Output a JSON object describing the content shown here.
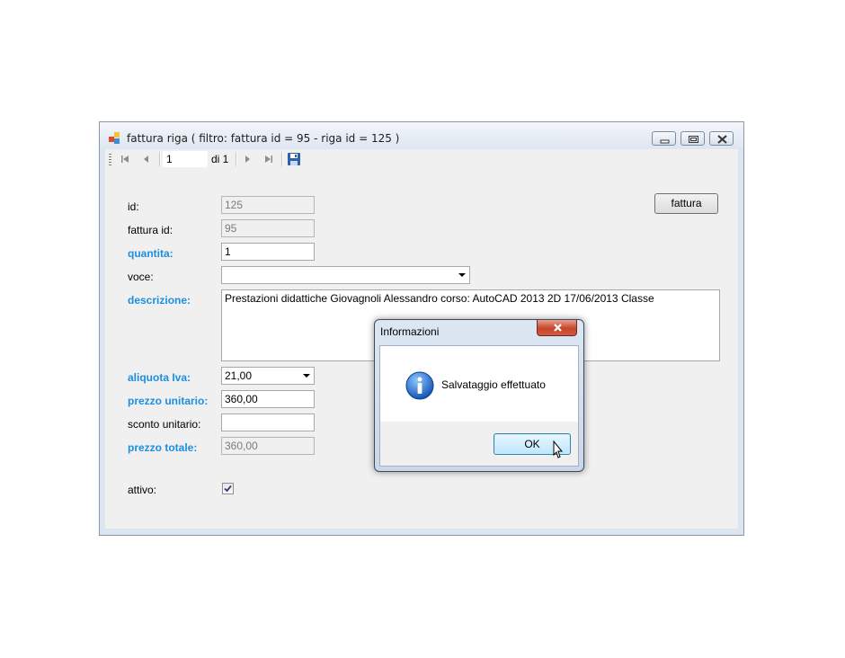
{
  "window": {
    "title": "fattura riga ( filtro: fattura id = 95 - riga id = 125 )"
  },
  "navigator": {
    "position": "1",
    "count_label": "di 1"
  },
  "form": {
    "fattura_button": "fattura",
    "fields": {
      "id": {
        "label": "id:",
        "value": "125"
      },
      "fattura_id": {
        "label": "fattura id:",
        "value": "95"
      },
      "quantita": {
        "label": "quantita:",
        "value": "1"
      },
      "voce": {
        "label": "voce:",
        "value": ""
      },
      "descrizione": {
        "label": "descrizione:",
        "value": "Prestazioni didattiche Giovagnoli Alessandro corso: AutoCAD 2013 2D 17/06/2013 Classe"
      },
      "aliquota_iva": {
        "label": "aliquota Iva:",
        "value": "21,00"
      },
      "prezzo_unitario": {
        "label": "prezzo unitario:",
        "value": "360,00"
      },
      "sconto_unitario": {
        "label": "sconto unitario:",
        "value": ""
      },
      "prezzo_totale": {
        "label": "prezzo totale:",
        "value": "360,00"
      },
      "attivo": {
        "label": "attivo:",
        "checked": true
      }
    }
  },
  "dialog": {
    "title": "Informazioni",
    "message": "Salvataggio effettuato",
    "ok_label": "OK",
    "icon": "info-icon"
  },
  "colors": {
    "required_label": "#1c8fe0",
    "ok_button_border": "#3c7fb1"
  }
}
